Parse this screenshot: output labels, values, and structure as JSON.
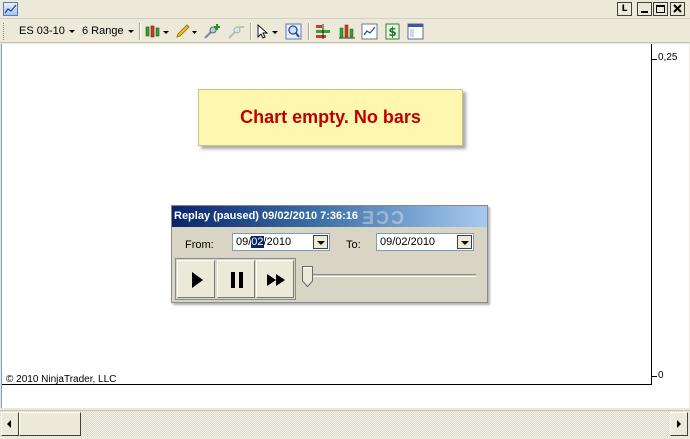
{
  "window": {
    "title": "",
    "buttons": {
      "layout": "L"
    }
  },
  "toolbar": {
    "instrument": "ES 03-10",
    "bar_type": "6 Range",
    "icons": [
      "chart-style-icon",
      "drawing-tool-icon",
      "add-indicator-icon",
      "remove-indicator-icon",
      "cursor-icon",
      "zoom-icon",
      "strategy-icon",
      "bars-icon",
      "data-box-icon",
      "dollar-icon",
      "properties-icon"
    ]
  },
  "chart": {
    "message": "Chart empty. No bars",
    "y_axis": {
      "top_label": "0,25",
      "bottom_label": "0"
    },
    "copyright": "© 2010 NinjaTrader, LLC"
  },
  "replay": {
    "title": "Replay (paused) 09/02/2010 7:36:16",
    "title_watermark": "ƎϽϽ",
    "from_label": "From:",
    "from_value_prefix": "09/",
    "from_value_selected": "02",
    "from_value_suffix": "/2010",
    "to_label": "To:",
    "to_value": "09/02/2010",
    "controls": [
      "play-icon",
      "pause-icon",
      "fast-forward-icon"
    ],
    "progress": 0
  },
  "colors": {
    "message_text": "#c00000",
    "message_bg": "#fdf7b0",
    "title_gradient_start": "#0a246a",
    "title_gradient_end": "#a6caf0"
  }
}
